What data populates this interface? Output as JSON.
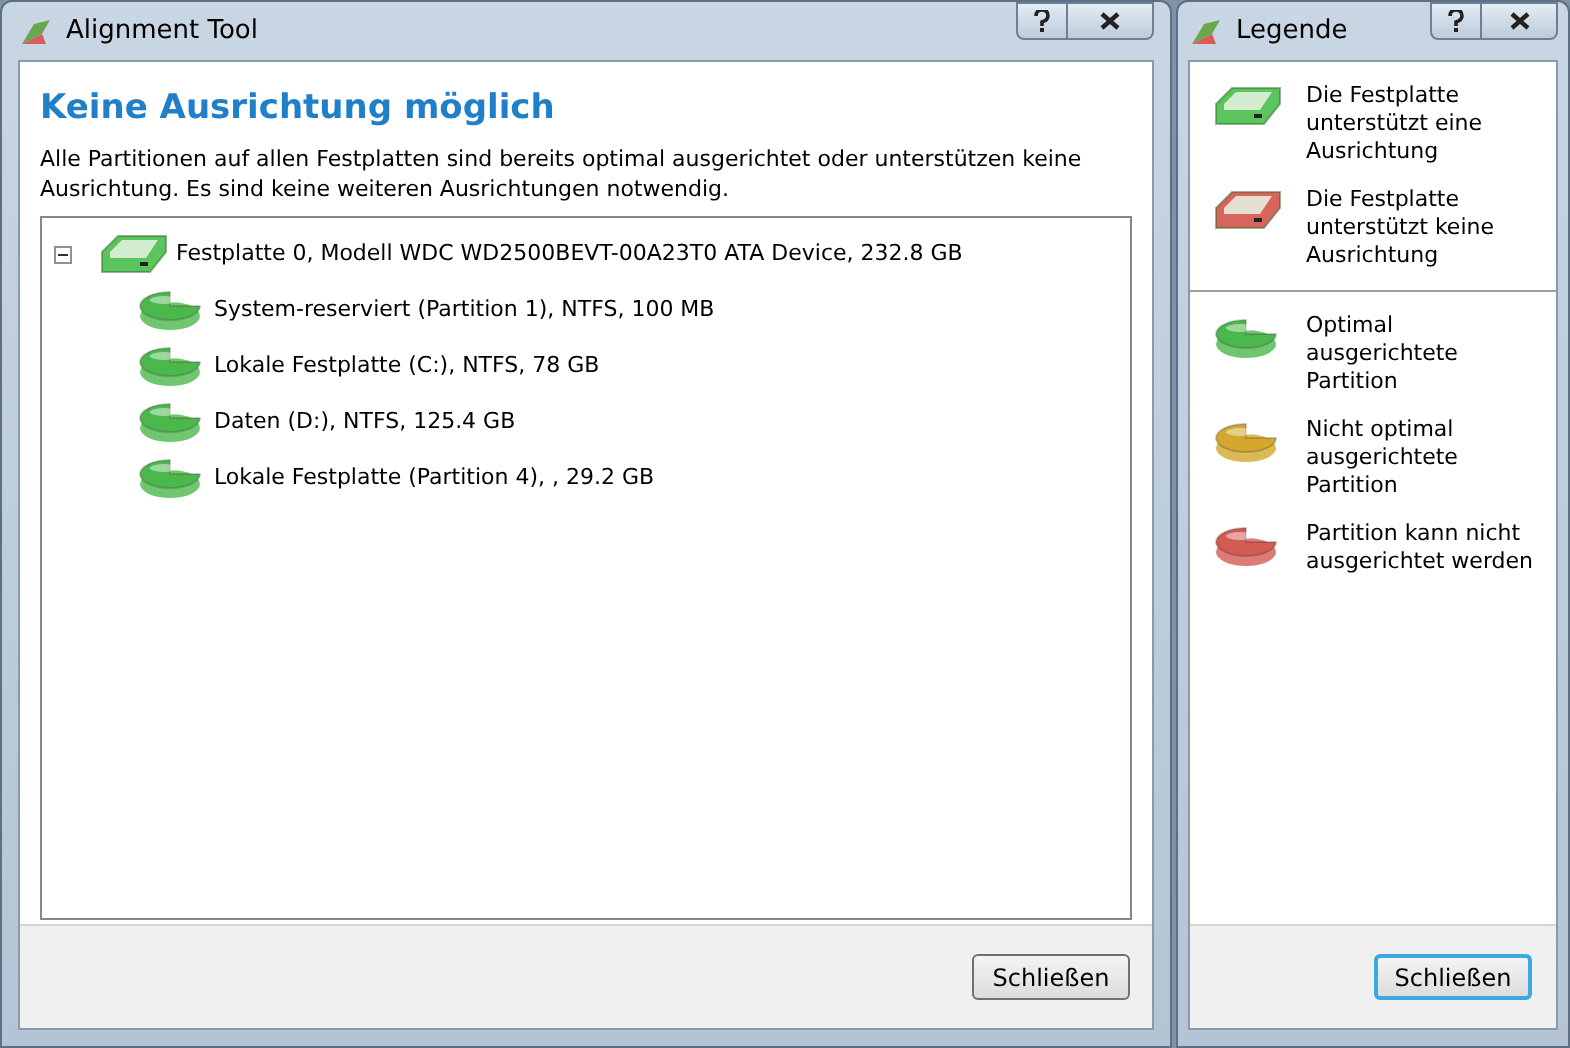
{
  "main_window": {
    "title": "Alignment Tool",
    "heading": "Keine Ausrichtung möglich",
    "description": "Alle Partitionen auf allen Festplatten sind bereits optimal ausgerichtet oder unterstützen keine Ausrichtung. Es sind keine weiteren Ausrichtungen notwendig.",
    "tree": [
      {
        "label": "Festplatte 0, Modell WDC WD2500BEVT-00A23T0 ATA Device, 232.8 GB",
        "kind": "disk",
        "color": "#5cc45c",
        "expanded": true,
        "children": [
          {
            "label": "System-reserviert (Partition 1), NTFS, 100 MB",
            "kind": "partition",
            "color": "#4cb84c"
          },
          {
            "label": "Lokale Festplatte (C:), NTFS, 78 GB",
            "kind": "partition",
            "color": "#4cb84c"
          },
          {
            "label": "Daten (D:), NTFS, 125.4 GB",
            "kind": "partition",
            "color": "#4cb84c"
          },
          {
            "label": "Lokale Festplatte (Partition 4), , 29.2 GB",
            "kind": "partition",
            "color": "#4cb84c"
          }
        ]
      }
    ],
    "button": {
      "label": "Schließen",
      "default": false
    }
  },
  "legend_window": {
    "title": "Legende",
    "groups": [
      [
        {
          "kind": "disk",
          "color": "#5cc45c",
          "text": "Die Festplatte unterstützt eine Ausrichtung"
        },
        {
          "kind": "disk",
          "color": "#d8645c",
          "text": "Die Festplatte unterstützt keine Ausrichtung"
        }
      ],
      [
        {
          "kind": "partition",
          "color": "#4cb84c",
          "text": "Optimal ausgerichtete Partition"
        },
        {
          "kind": "partition",
          "color": "#d4a82c",
          "text": "Nicht optimal ausgerichtete Partition"
        },
        {
          "kind": "partition",
          "color": "#d45a54",
          "text": "Partition kann nicht ausgerichtet werden"
        }
      ]
    ],
    "button": {
      "label": "Schließen",
      "default": true
    }
  }
}
